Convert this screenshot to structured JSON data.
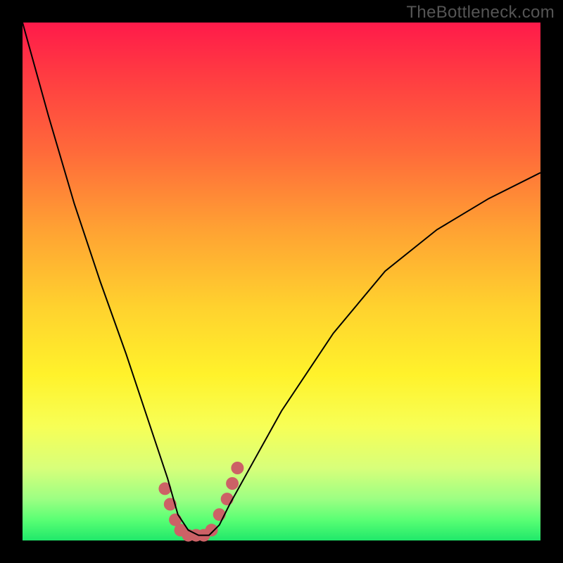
{
  "watermark": "TheBottleneck.com",
  "chart_data": {
    "type": "line",
    "title": "",
    "xlabel": "",
    "ylabel": "",
    "x": [
      0.0,
      0.05,
      0.1,
      0.15,
      0.2,
      0.25,
      0.28,
      0.3,
      0.32,
      0.34,
      0.36,
      0.38,
      0.4,
      0.45,
      0.5,
      0.6,
      0.7,
      0.8,
      0.9,
      1.0
    ],
    "y": [
      1.0,
      0.82,
      0.65,
      0.5,
      0.36,
      0.21,
      0.12,
      0.05,
      0.02,
      0.01,
      0.01,
      0.03,
      0.07,
      0.16,
      0.25,
      0.4,
      0.52,
      0.6,
      0.66,
      0.71
    ],
    "ylim": [
      0,
      1
    ],
    "xlim": [
      0,
      1
    ],
    "series": [
      {
        "name": "curve",
        "color": "#000000",
        "stroke_width": 2
      }
    ],
    "markers": {
      "color": "#cc6166",
      "radius": 9,
      "points": [
        {
          "x": 0.275,
          "y": 0.1
        },
        {
          "x": 0.285,
          "y": 0.07
        },
        {
          "x": 0.295,
          "y": 0.04
        },
        {
          "x": 0.305,
          "y": 0.02
        },
        {
          "x": 0.32,
          "y": 0.01
        },
        {
          "x": 0.335,
          "y": 0.01
        },
        {
          "x": 0.35,
          "y": 0.01
        },
        {
          "x": 0.365,
          "y": 0.02
        },
        {
          "x": 0.38,
          "y": 0.05
        },
        {
          "x": 0.395,
          "y": 0.08
        },
        {
          "x": 0.405,
          "y": 0.11
        },
        {
          "x": 0.415,
          "y": 0.14
        }
      ]
    },
    "background": {
      "gradient_stops": [
        {
          "pos": 0.0,
          "color": "#ff1a4a"
        },
        {
          "pos": 0.25,
          "color": "#ff6a3a"
        },
        {
          "pos": 0.55,
          "color": "#ffd22e"
        },
        {
          "pos": 0.78,
          "color": "#f7ff56"
        },
        {
          "pos": 1.0,
          "color": "#20e86a"
        }
      ]
    }
  }
}
